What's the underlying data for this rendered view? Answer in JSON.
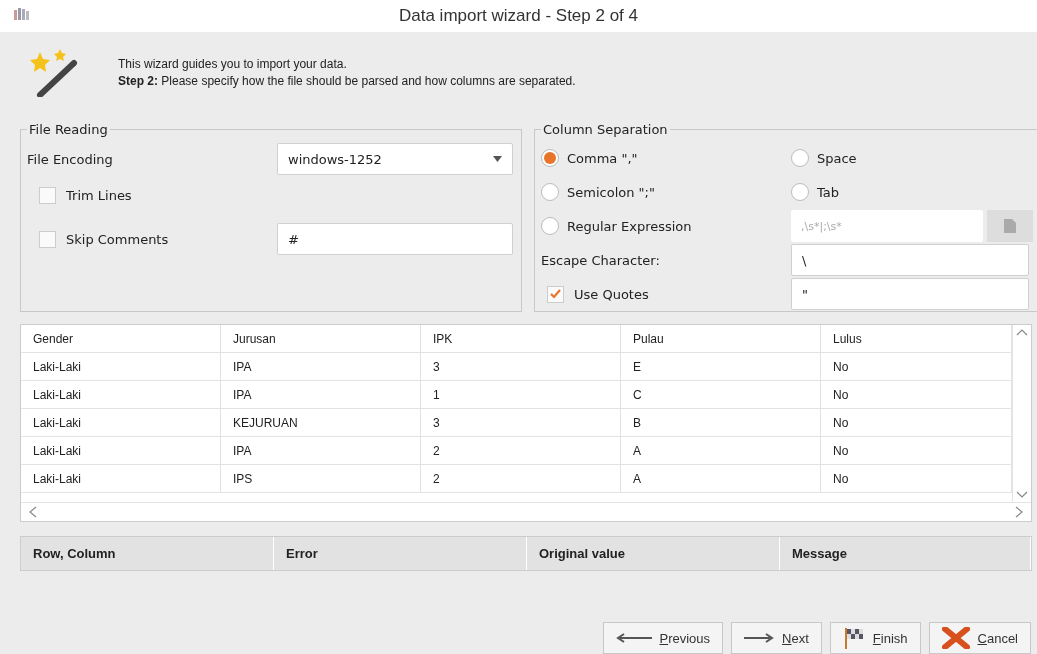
{
  "window": {
    "title": "Data import wizard - Step 2 of 4"
  },
  "intro": {
    "line1": "This wizard guides you to import your data.",
    "line2": "**Step 2:** Please specify how the file should be parsed and how columns are separated."
  },
  "file_reading": {
    "title": "File Reading",
    "encoding_label": "File Encoding",
    "encoding_value": "windows-1252",
    "trim_lines": {
      "label": "Trim Lines",
      "checked": false
    },
    "skip_comments": {
      "label": "Skip Comments",
      "checked": false,
      "value": "#"
    }
  },
  "column_separation": {
    "title": "Column Separation",
    "options": [
      {
        "label": "Comma \",\"",
        "selected": true
      },
      {
        "label": "Space",
        "selected": false
      },
      {
        "label": "Semicolon \";\"",
        "selected": false
      },
      {
        "label": "Tab",
        "selected": false
      },
      {
        "label": "Regular Expression",
        "selected": false
      }
    ],
    "regex_value": ",\\s*|;\\s*",
    "escape_label": "Escape Character:",
    "escape_value": "\\",
    "use_quotes": {
      "label": "Use Quotes",
      "checked": true,
      "value": "\""
    }
  },
  "table": {
    "columns": [
      "Gender",
      "Jurusan",
      "IPK",
      "Pulau",
      "Lulus"
    ],
    "rows": [
      [
        "Laki-Laki",
        "IPA",
        "3",
        "E",
        "No"
      ],
      [
        "Laki-Laki",
        "IPA",
        "1",
        "C",
        "No"
      ],
      [
        "Laki-Laki",
        "KEJURUAN",
        "3",
        "B",
        "No"
      ],
      [
        "Laki-Laki",
        "IPA",
        "2",
        "A",
        "No"
      ],
      [
        "Laki-Laki",
        "IPS",
        "2",
        "A",
        "No"
      ]
    ]
  },
  "errors": {
    "columns": [
      "Row, Column",
      "Error",
      "Original value",
      "Message"
    ]
  },
  "buttons": [
    {
      "kind": "previous",
      "label": "Previous"
    },
    {
      "kind": "next",
      "label": "Next"
    },
    {
      "kind": "finish",
      "label": "Finish"
    },
    {
      "kind": "cancel",
      "label": "Cancel"
    }
  ]
}
